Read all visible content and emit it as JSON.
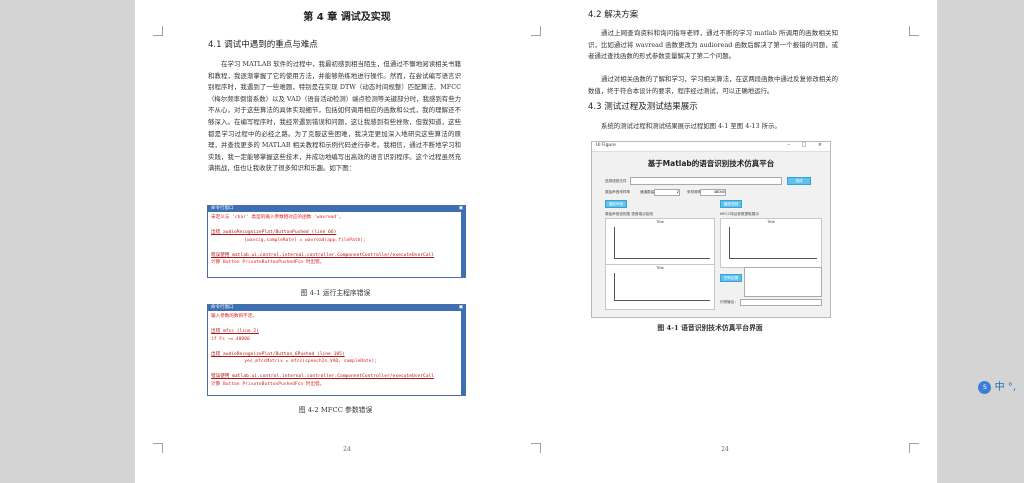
{
  "page1": {
    "chapter_title": "第 4 章  调试及实现",
    "section_title": "4.1 调试中遇到的重点与难点",
    "paragraph": "在学习 MATLAB 软件的过程中，我最初感到相当陌生，但通过不懈地阅读相关书籍和教程，我逐渐掌握了它的使用方法，并能够熟练地进行操作。然而，在尝试编写语言识别程序时，我遇到了一些难题，特别是在实现 DTW（动态时间规整）匹配算法、MFCC（梅尔频率倒谱系数）以及 VAD（语音活动检测）端点检测等关键部分时，我感到有些力不从心，对于这些算法的具体实现细节，包括如何调用相应的函数和公式，我的理解还不够深入。在编写程序时，我经常遇到错误和问题，这让我感到有些挫败，但我知道，这些都是学习过程中的必经之路。为了克服这些困难，我决定更加深入地研究这些算法的原理，并查找更多的 MATLAB 相关教程和示例代码进行参考。我相信，通过不断地学习和实践，我一定能够掌握这些技术，并成功地编写出高效的语言识别程序。这个过程虽然充满挑战，但也让我收获了很多知识和乐趣。如下图：",
    "window1": {
      "title": "命令行窗口",
      "lines": [
        "未定义与 'char' 类型的输入参数相对应的函数 'wavread'。",
        "",
        "出错 audioRecognizePlat/ButtonPushed (line 66)",
        "            [wavsig,sampleRate] = wavread(app.filePath);",
        "",
        "错误使用 matlab.ui.control.internal.controller.ComponentController/executeUserCall",
        "计算 Button PrivateButtonPushedFcn 时出错。"
      ]
    },
    "caption1": "图 4-1  运行主程序错误",
    "window2": {
      "title": "命令行窗口",
      "lines": [
        "输入参数的数目不足。",
        "",
        "出错 mfcc (line 2)",
        "if Fs ~= 48000",
        "",
        "出错 audioRecognizePlat/Button_6Pushed (line 105)",
        "            yes_mfccMatrix = mfcc(speech2s_VAD, sampleRate);",
        "",
        "错误使用 matlab.ui.control.internal.controller.ComponentController/executeUserCall",
        "计算 Button PrivateButtonPushedFcn 时出错。"
      ]
    },
    "caption2": "图 4-2 MFCC 参数错误",
    "page_number": "24"
  },
  "page2": {
    "section_title": "4.2 解决方案",
    "paragraph1": "通过上网查询资料和询问指导老师，通过不断的学习 matlab 所调用的函数相关知识，比如通过将 wavread 函数更改为 audioread 函数后解决了第一个报错的问题，或者通过查找函数的形式参数变量解决了第二个问题。",
    "paragraph2": "通过对相关函数的了解和学习，学习相关算法，在这两段函数中通过反复修改相关的数值，终于符合本设计的要求，程序经过测试，可以正确地运行。",
    "section_title2": "4.3 测试过程及测试结果展示",
    "paragraph3": "系统的测试过程和测试结果展示过程如图 4-1 至图 4-13 所示。",
    "figure": {
      "window_title": "UI Figure",
      "window_controls": "–  □  ×",
      "app_title": "基于Matlab的语音识别技术仿真平台",
      "select_button": "选择",
      "label_file": "选择语音文件",
      "label_samplerate": "原始声音采样率",
      "label_channels": "通道数量",
      "channels_value": "2",
      "label_rate": "采样频率",
      "rate_value": "48000",
      "btn_play": "播放声音",
      "btn_voice": "播放语音",
      "panel_left_title": "原始声音波形图 语音端点检测",
      "panel_right_title": "MFCC特征参数提取展示",
      "axes_title": "Title",
      "btn_recognize": "识别结果",
      "label_result": "识别输出："
    },
    "caption": "图 4-1  语音识别技术仿真平台界面",
    "page_number": "24"
  },
  "ime": {
    "label": "中",
    "dot": "°,"
  }
}
